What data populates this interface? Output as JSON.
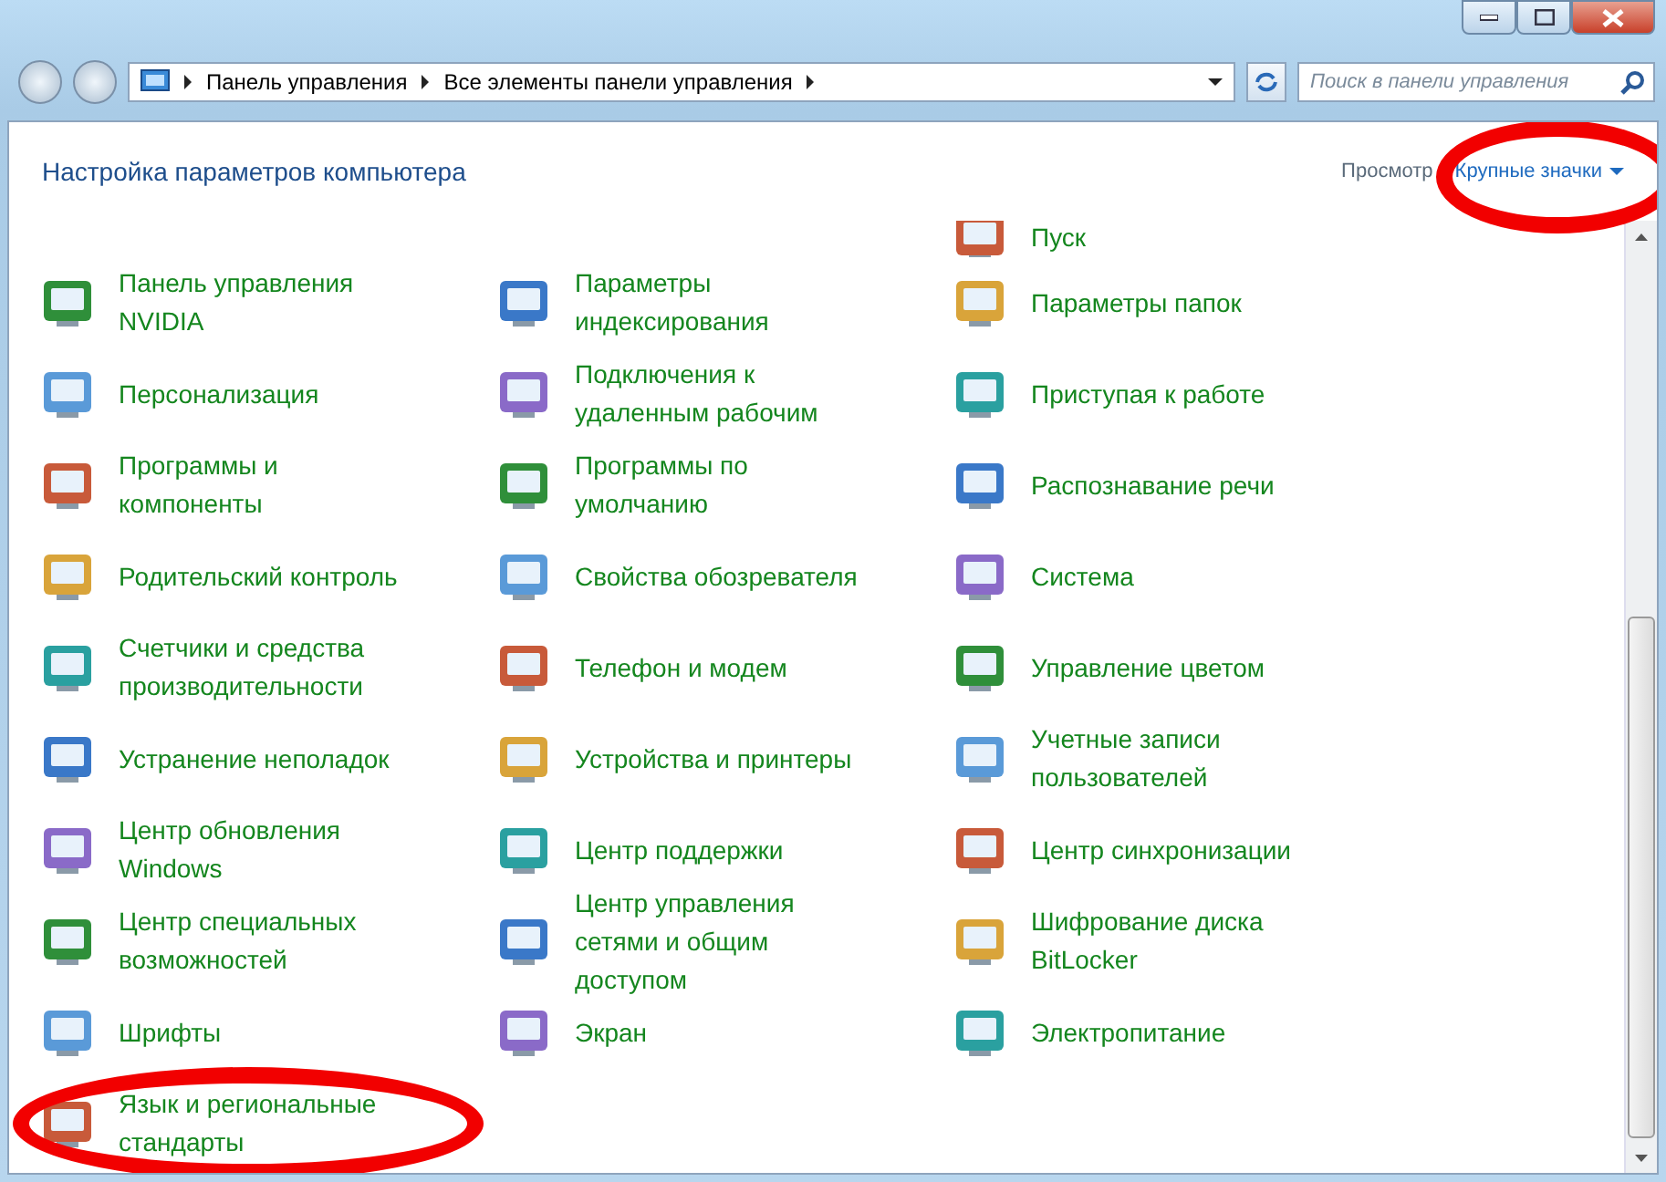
{
  "address_bar": {
    "breadcrumbs": [
      "Панель управления",
      "Все элементы панели управления"
    ]
  },
  "search": {
    "placeholder": "Поиск в панели управления"
  },
  "header": {
    "title": "Настройка параметров компьютера",
    "view_label": "Просмотр",
    "view_value": "Крупные значки",
    "view_circled": true
  },
  "clipped_row": [
    {
      "label": "Пуск"
    }
  ],
  "items": [
    {
      "label": "Панель управления NVIDIA",
      "circled": false
    },
    {
      "label": "Параметры индексирования",
      "circled": false
    },
    {
      "label": "Параметры папок",
      "circled": false
    },
    {
      "label": "Персонализация",
      "circled": false
    },
    {
      "label": "Подключения к удаленным рабочим",
      "circled": false
    },
    {
      "label": "Приступая к работе",
      "circled": false
    },
    {
      "label": "Программы и компоненты",
      "circled": false
    },
    {
      "label": "Программы по умолчанию",
      "circled": false
    },
    {
      "label": "Распознавание речи",
      "circled": false
    },
    {
      "label": "Родительский контроль",
      "circled": false
    },
    {
      "label": "Свойства обозревателя",
      "circled": false
    },
    {
      "label": "Система",
      "circled": false
    },
    {
      "label": "Счетчики и средства производительности",
      "circled": false
    },
    {
      "label": "Телефон и модем",
      "circled": false
    },
    {
      "label": "Управление цветом",
      "circled": false
    },
    {
      "label": "Устранение неполадок",
      "circled": false
    },
    {
      "label": "Устройства и принтеры",
      "circled": false
    },
    {
      "label": "Учетные записи пользователей",
      "circled": false
    },
    {
      "label": "Центр обновления Windows",
      "circled": false
    },
    {
      "label": "Центр поддержки",
      "circled": false
    },
    {
      "label": "Центр синхронизации",
      "circled": false
    },
    {
      "label": "Центр специальных возможностей",
      "circled": false
    },
    {
      "label": "Центр управления сетями и общим доступом",
      "circled": false
    },
    {
      "label": "Шифрование диска BitLocker",
      "circled": false
    },
    {
      "label": "Шрифты",
      "circled": false
    },
    {
      "label": "Экран",
      "circled": false
    },
    {
      "label": "Электропитание",
      "circled": false
    },
    {
      "label": "Язык и региональные стандарты",
      "circled": true
    }
  ]
}
